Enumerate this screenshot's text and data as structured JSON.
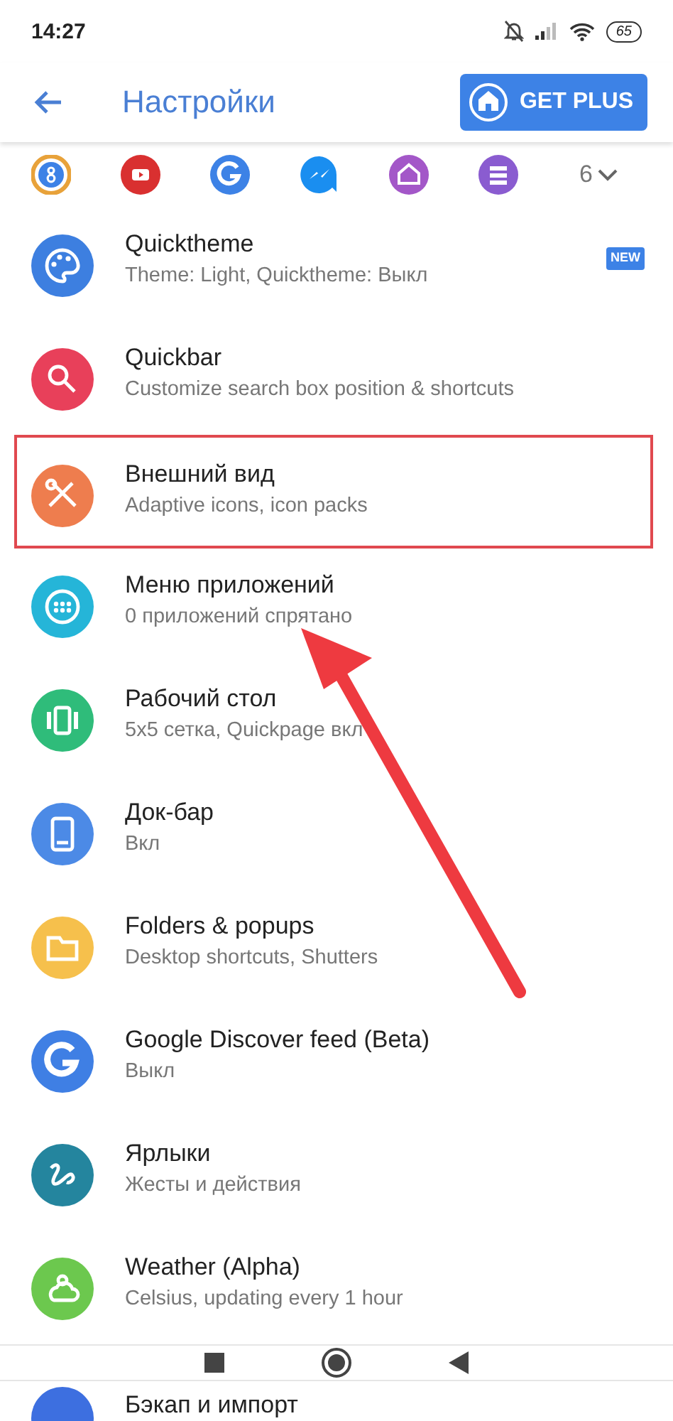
{
  "status_bar": {
    "time": "14:27",
    "battery": "65"
  },
  "toolbar": {
    "title": "Настройки",
    "plus_button": "GET PLUS"
  },
  "shortcuts": {
    "count": "6"
  },
  "items": [
    {
      "title": "Quicktheme",
      "subtitle": "Theme: Light, Quicktheme: Выкл",
      "badge": "NEW",
      "highlighted": false
    },
    {
      "title": "Quickbar",
      "subtitle": "Customize search box position & shortcuts",
      "highlighted": false
    },
    {
      "title": "Внешний вид",
      "subtitle": "Adaptive icons, icon packs",
      "highlighted": true
    },
    {
      "title": "Меню приложений",
      "subtitle": "0 приложений спрятано",
      "highlighted": false
    },
    {
      "title": "Рабочий стол",
      "subtitle": "5x5 сетка, Quickpage вкл",
      "highlighted": false
    },
    {
      "title": "Док-бар",
      "subtitle": "Вкл",
      "highlighted": false
    },
    {
      "title": "Folders & popups",
      "subtitle": "Desktop shortcuts, Shutters",
      "highlighted": false
    },
    {
      "title": "Google Discover feed (Beta)",
      "subtitle": "Выкл",
      "highlighted": false
    },
    {
      "title": "Ярлыки",
      "subtitle": "Жесты и действия",
      "highlighted": false
    },
    {
      "title": "Weather (Alpha)",
      "subtitle": "Celsius, updating every 1 hour",
      "highlighted": false
    },
    {
      "title": "Бэкап и импорт",
      "highlighted": false
    }
  ]
}
